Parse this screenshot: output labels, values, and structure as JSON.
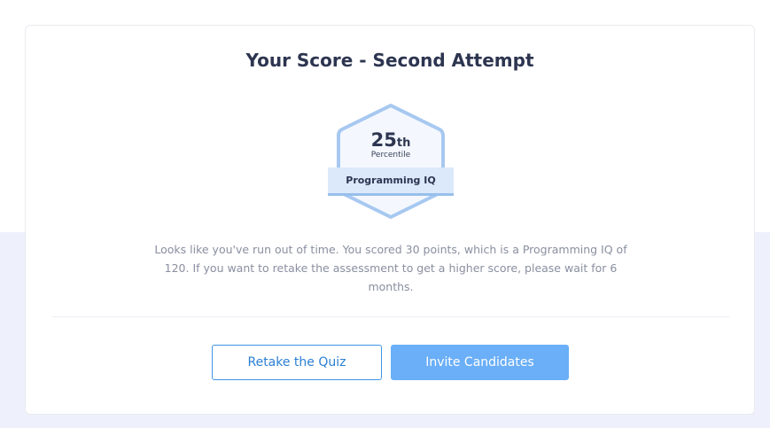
{
  "score": {
    "title": "Your Score - Second Attempt",
    "percentile_value": "25",
    "percentile_suffix": "th",
    "percentile_label": "Percentile",
    "badge_label": "Programming IQ"
  },
  "message": "Looks like you've run out of time. You scored 30 points, which is a Programming IQ of 120. If you want to retake the assessment to get a higher score, please wait for 6 months.",
  "actions": {
    "retake_label": "Retake the Quiz",
    "invite_label": "Invite Candidates"
  },
  "colors": {
    "accent": "#6aaff7",
    "outline_accent": "#3e95e6",
    "badge_border": "#a7c8f0",
    "badge_fill": "#f4f8fe",
    "ribbon_fill": "#dbe9fb",
    "background_band": "#eef1fb",
    "title_text": "#2d3550",
    "body_text": "#8a8fa0"
  }
}
